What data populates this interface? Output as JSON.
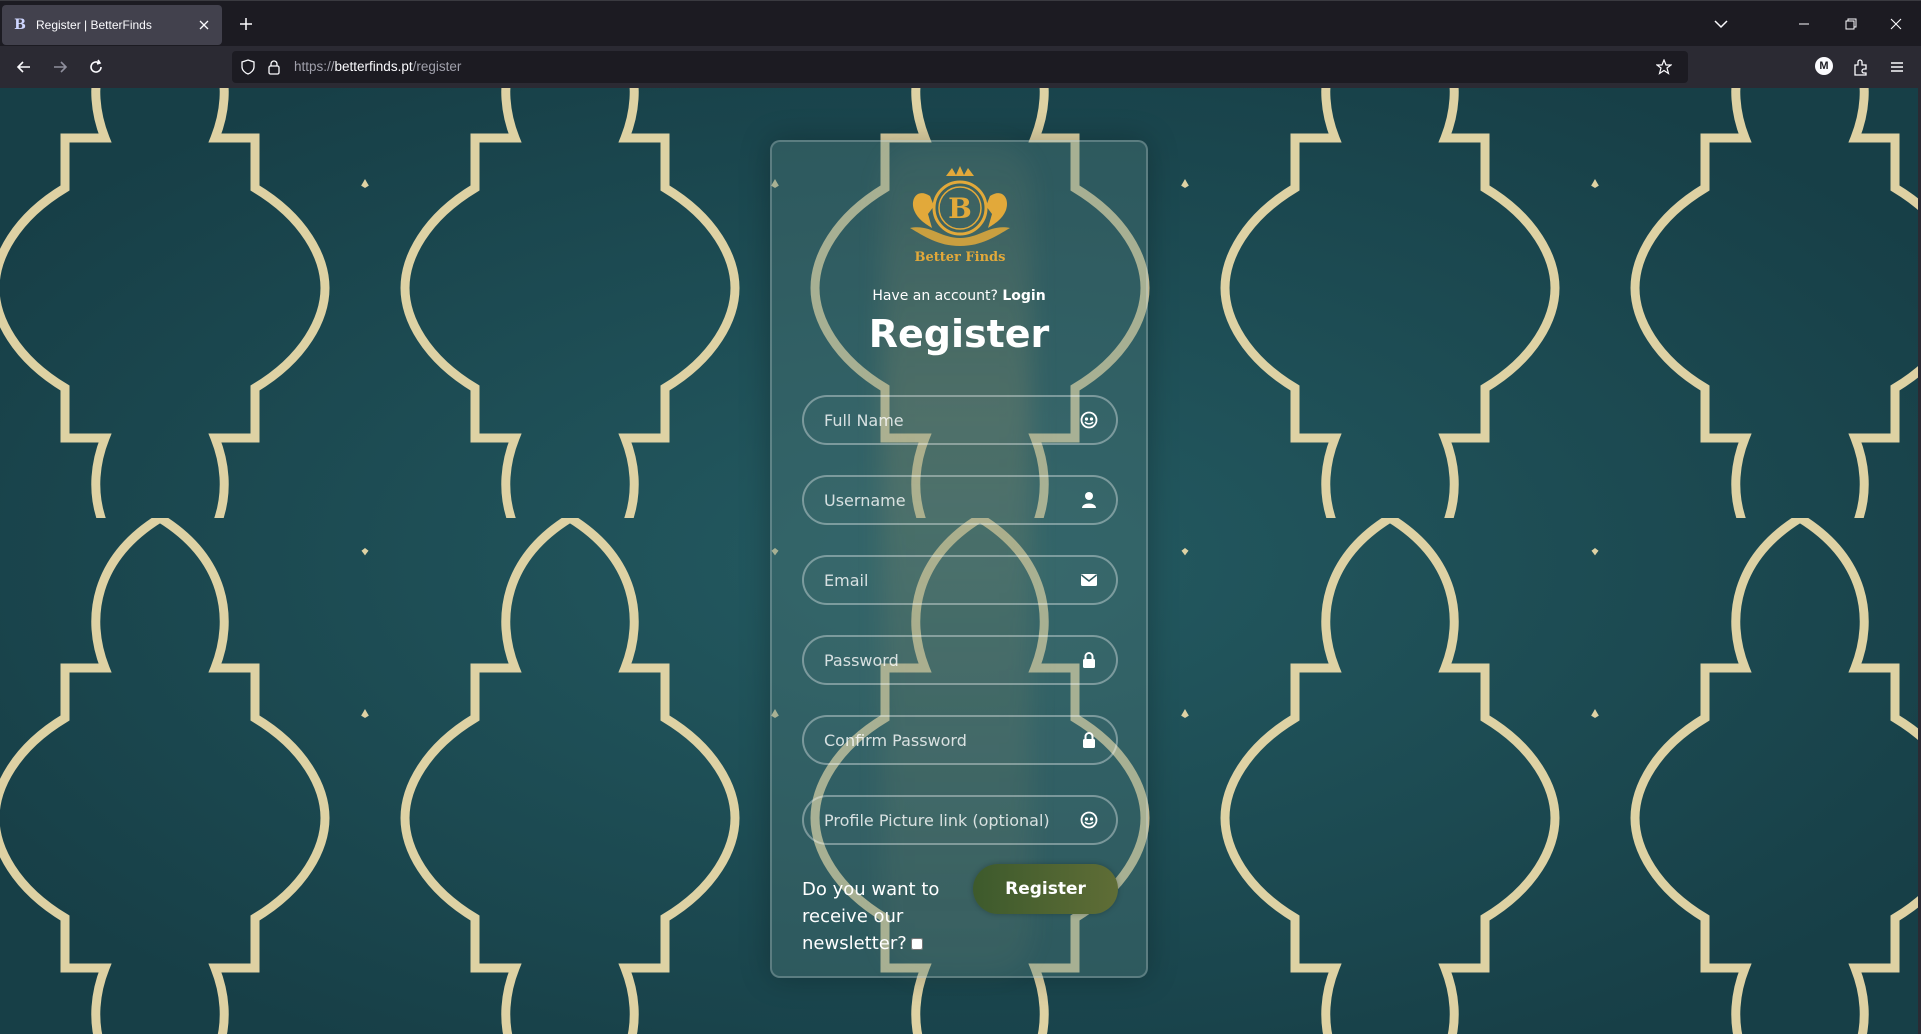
{
  "browser": {
    "tab_title": "Register | BetterFinds",
    "tab_favicon": "B",
    "url_scheme": "https://",
    "url_host": "betterfinds.pt",
    "url_path": "/register",
    "profile_initial": "M"
  },
  "page": {
    "logo_text": "Better Finds",
    "logo_letter": "B",
    "have_account_text": "Have an account?",
    "login_link": "Login",
    "title": "Register",
    "fields": [
      {
        "placeholder": "Full Name",
        "icon": "face-icon",
        "type": "text"
      },
      {
        "placeholder": "Username",
        "icon": "user-icon",
        "type": "text"
      },
      {
        "placeholder": "Email",
        "icon": "envelope-icon",
        "type": "email"
      },
      {
        "placeholder": "Password",
        "icon": "lock-icon",
        "type": "password"
      },
      {
        "placeholder": "Confirm Password",
        "icon": "lock-icon",
        "type": "password"
      },
      {
        "placeholder": "Profile Picture link (optional)",
        "icon": "face-icon",
        "type": "text"
      }
    ],
    "newsletter_label": "Do you want to receive our newsletter?",
    "newsletter_checked": false,
    "register_button": "Register"
  },
  "colors": {
    "background": "#1e4d55",
    "pattern_gold": "#e8d9a8",
    "logo_gold": "#e2a93a",
    "button": "#4d6430"
  }
}
